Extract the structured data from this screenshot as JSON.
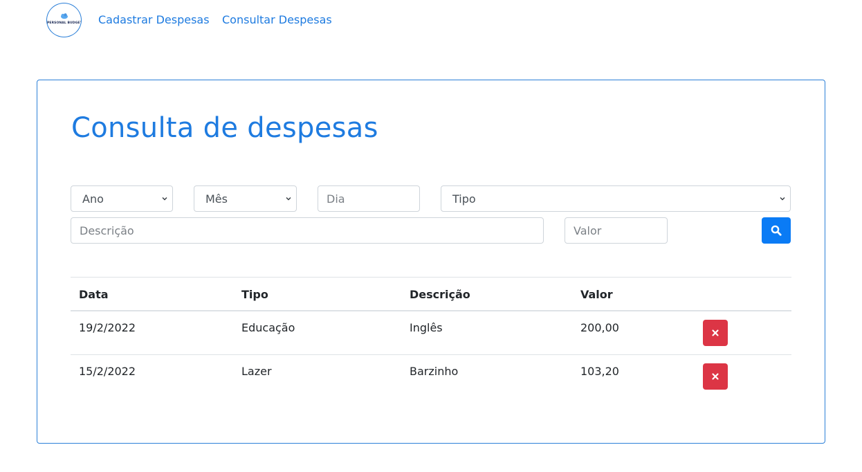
{
  "nav": {
    "logo_text": "PERSONAL BUDGET",
    "links": [
      {
        "label": "Cadastrar Despesas"
      },
      {
        "label": "Consultar Despesas"
      }
    ]
  },
  "main": {
    "title": "Consulta de despesas",
    "filters": {
      "ano": {
        "value": "Ano",
        "icon": "chevron-down-icon"
      },
      "mes": {
        "value": "Mês",
        "icon": "chevron-down-icon"
      },
      "dia": {
        "placeholder": "Dia"
      },
      "tipo": {
        "value": "Tipo",
        "icon": "chevron-down-icon"
      },
      "descricao": {
        "placeholder": "Descrição"
      },
      "valor": {
        "placeholder": "Valor"
      },
      "search_icon": "search-icon"
    },
    "table": {
      "headers": [
        "Data",
        "Tipo",
        "Descrição",
        "Valor"
      ],
      "rows": [
        {
          "data": "19/2/2022",
          "tipo": "Educação",
          "descricao": "Inglês",
          "valor": "200,00"
        },
        {
          "data": "15/2/2022",
          "tipo": "Lazer",
          "descricao": "Barzinho",
          "valor": "103,20"
        }
      ],
      "delete_icon": "close-icon"
    }
  },
  "colors": {
    "primary": "#1e7be0",
    "search_button": "#0a7bf5",
    "danger": "#dc3545",
    "border": "#2b7fd8"
  }
}
